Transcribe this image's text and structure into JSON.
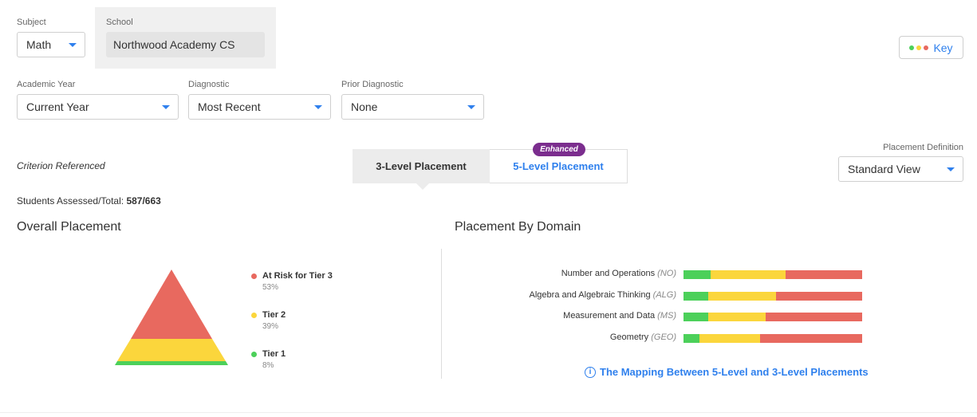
{
  "filters": {
    "subject": {
      "label": "Subject",
      "value": "Math"
    },
    "school": {
      "label": "School",
      "value": "Northwood Academy CS"
    },
    "academic_year": {
      "label": "Academic Year",
      "value": "Current Year"
    },
    "diagnostic": {
      "label": "Diagnostic",
      "value": "Most Recent"
    },
    "prior_diagnostic": {
      "label": "Prior Diagnostic",
      "value": "None"
    }
  },
  "key_button": {
    "label": "Key",
    "dot_colors": [
      "#4cd05a",
      "#fbd63c",
      "#e8695f"
    ]
  },
  "criterion": "Criterion Referenced",
  "placement_toggle": {
    "badge": "Enhanced",
    "three_level": "3-Level Placement",
    "five_level": "5-Level Placement",
    "active": "3-Level Placement"
  },
  "placement_definition": {
    "label": "Placement Definition",
    "value": "Standard View"
  },
  "students_assessed": {
    "label": "Students Assessed/Total:",
    "value": "587/663"
  },
  "overall_placement": {
    "title": "Overall Placement",
    "legend": [
      {
        "name": "At Risk for Tier 3",
        "pct": "53%",
        "color": "#e8695f"
      },
      {
        "name": "Tier 2",
        "pct": "39%",
        "color": "#fbd63c"
      },
      {
        "name": "Tier 1",
        "pct": "8%",
        "color": "#4cd05a"
      }
    ]
  },
  "placement_by_domain": {
    "title": "Placement By Domain",
    "domains": [
      {
        "name": "Number and Operations",
        "abbr": "(NO)",
        "green": 15,
        "yellow": 42,
        "red": 43
      },
      {
        "name": "Algebra and Algebraic Thinking",
        "abbr": "(ALG)",
        "green": 14,
        "yellow": 38,
        "red": 48
      },
      {
        "name": "Measurement and Data",
        "abbr": "(MS)",
        "green": 14,
        "yellow": 32,
        "red": 54
      },
      {
        "name": "Geometry",
        "abbr": "(GEO)",
        "green": 9,
        "yellow": 34,
        "red": 57
      }
    ],
    "mapping_link": "The Mapping Between 5-Level and 3-Level Placements"
  },
  "colors": {
    "red": "#e8695f",
    "yellow": "#fbd63c",
    "green": "#4cd05a",
    "accent": "#2f80ed",
    "badge": "#7b2d8e"
  }
}
